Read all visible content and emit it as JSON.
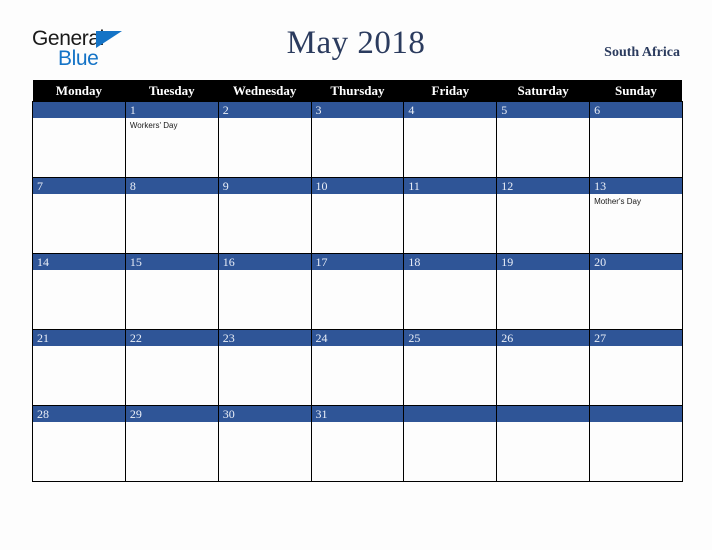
{
  "brand": {
    "name_part1": "General",
    "name_part2": "Blue",
    "triangle_icon": "triangle-icon",
    "colors": {
      "black": "#1a1a1a",
      "blue": "#1473c6"
    }
  },
  "header": {
    "title": "May 2018",
    "locale": "South Africa",
    "title_color": "#2b3b5e"
  },
  "calendar": {
    "weekday_headers": [
      "Monday",
      "Tuesday",
      "Wednesday",
      "Thursday",
      "Friday",
      "Saturday",
      "Sunday"
    ],
    "header_bg": "#000000",
    "daybar_bg": "#2f5597",
    "weeks": [
      [
        {
          "date": "",
          "events": []
        },
        {
          "date": "1",
          "events": [
            "Workers' Day"
          ]
        },
        {
          "date": "2",
          "events": []
        },
        {
          "date": "3",
          "events": []
        },
        {
          "date": "4",
          "events": []
        },
        {
          "date": "5",
          "events": []
        },
        {
          "date": "6",
          "events": []
        }
      ],
      [
        {
          "date": "7",
          "events": []
        },
        {
          "date": "8",
          "events": []
        },
        {
          "date": "9",
          "events": []
        },
        {
          "date": "10",
          "events": []
        },
        {
          "date": "11",
          "events": []
        },
        {
          "date": "12",
          "events": []
        },
        {
          "date": "13",
          "events": [
            "Mother's Day"
          ]
        }
      ],
      [
        {
          "date": "14",
          "events": []
        },
        {
          "date": "15",
          "events": []
        },
        {
          "date": "16",
          "events": []
        },
        {
          "date": "17",
          "events": []
        },
        {
          "date": "18",
          "events": []
        },
        {
          "date": "19",
          "events": []
        },
        {
          "date": "20",
          "events": []
        }
      ],
      [
        {
          "date": "21",
          "events": []
        },
        {
          "date": "22",
          "events": []
        },
        {
          "date": "23",
          "events": []
        },
        {
          "date": "24",
          "events": []
        },
        {
          "date": "25",
          "events": []
        },
        {
          "date": "26",
          "events": []
        },
        {
          "date": "27",
          "events": []
        }
      ],
      [
        {
          "date": "28",
          "events": []
        },
        {
          "date": "29",
          "events": []
        },
        {
          "date": "30",
          "events": []
        },
        {
          "date": "31",
          "events": []
        },
        {
          "date": "",
          "events": []
        },
        {
          "date": "",
          "events": []
        },
        {
          "date": "",
          "events": []
        }
      ]
    ]
  }
}
